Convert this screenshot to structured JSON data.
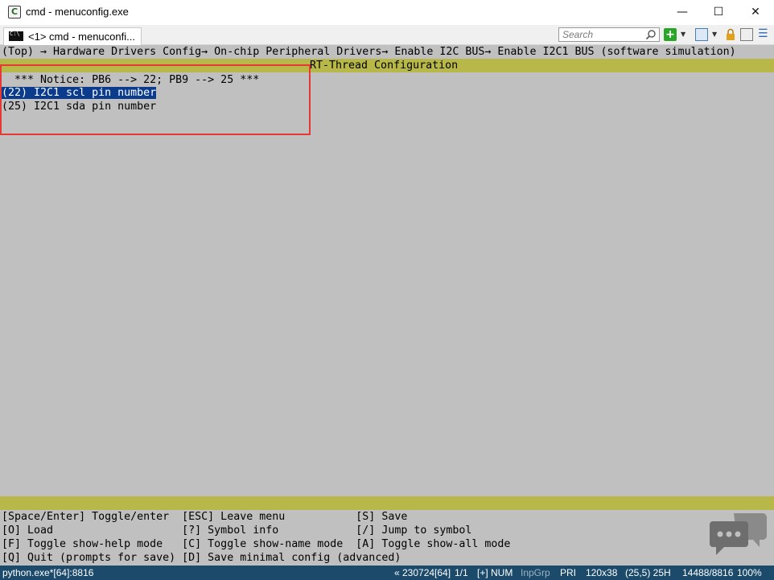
{
  "window": {
    "title": "cmd - menuconfig.exe",
    "min_glyph": "—",
    "max_glyph": "☐",
    "close_glyph": "✕"
  },
  "tabbar": {
    "tab_label": "<1> cmd - menuconfi...",
    "search_placeholder": "Search"
  },
  "terminal": {
    "breadcrumb": "(Top) → Hardware Drivers Config→ On-chip Peripheral Drivers→ Enable I2C BUS→ Enable I2C1 BUS (software simulation)",
    "config_title": "RT-Thread Configuration",
    "notice": "  *** Notice: PB6 --> 22; PB9 --> 25 ***",
    "items": [
      {
        "text": "(22) I2C1 scl pin number",
        "selected": true
      },
      {
        "text": "(25) I2C1 sda pin number",
        "selected": false
      }
    ],
    "help_lines": [
      "[Space/Enter] Toggle/enter  [ESC] Leave menu           [S] Save",
      "[O] Load                    [?] Symbol info            [/] Jump to symbol",
      "[F] Toggle show-help mode   [C] Toggle show-name mode  [A] Toggle show-all mode",
      "[Q] Quit (prompts for save) [D] Save minimal config (advanced)"
    ]
  },
  "statusbar": {
    "process": "python.exe*[64]:8816",
    "build": "« 230724[64]",
    "page": "1/1",
    "plus_mode": "[+] NUM",
    "input_group": "InpGrp",
    "priority": "PRI",
    "size": "120x38",
    "cursor": "(25,5) 25H",
    "memory": "14488/8816",
    "zoom": "100%"
  },
  "colors": {
    "terminal_bg": "#c0c0c0",
    "band": "#b8b84a",
    "selection": "#0a3b8c",
    "annotation_box": "#e53935",
    "statusbar_bg": "#1b4a6b"
  }
}
